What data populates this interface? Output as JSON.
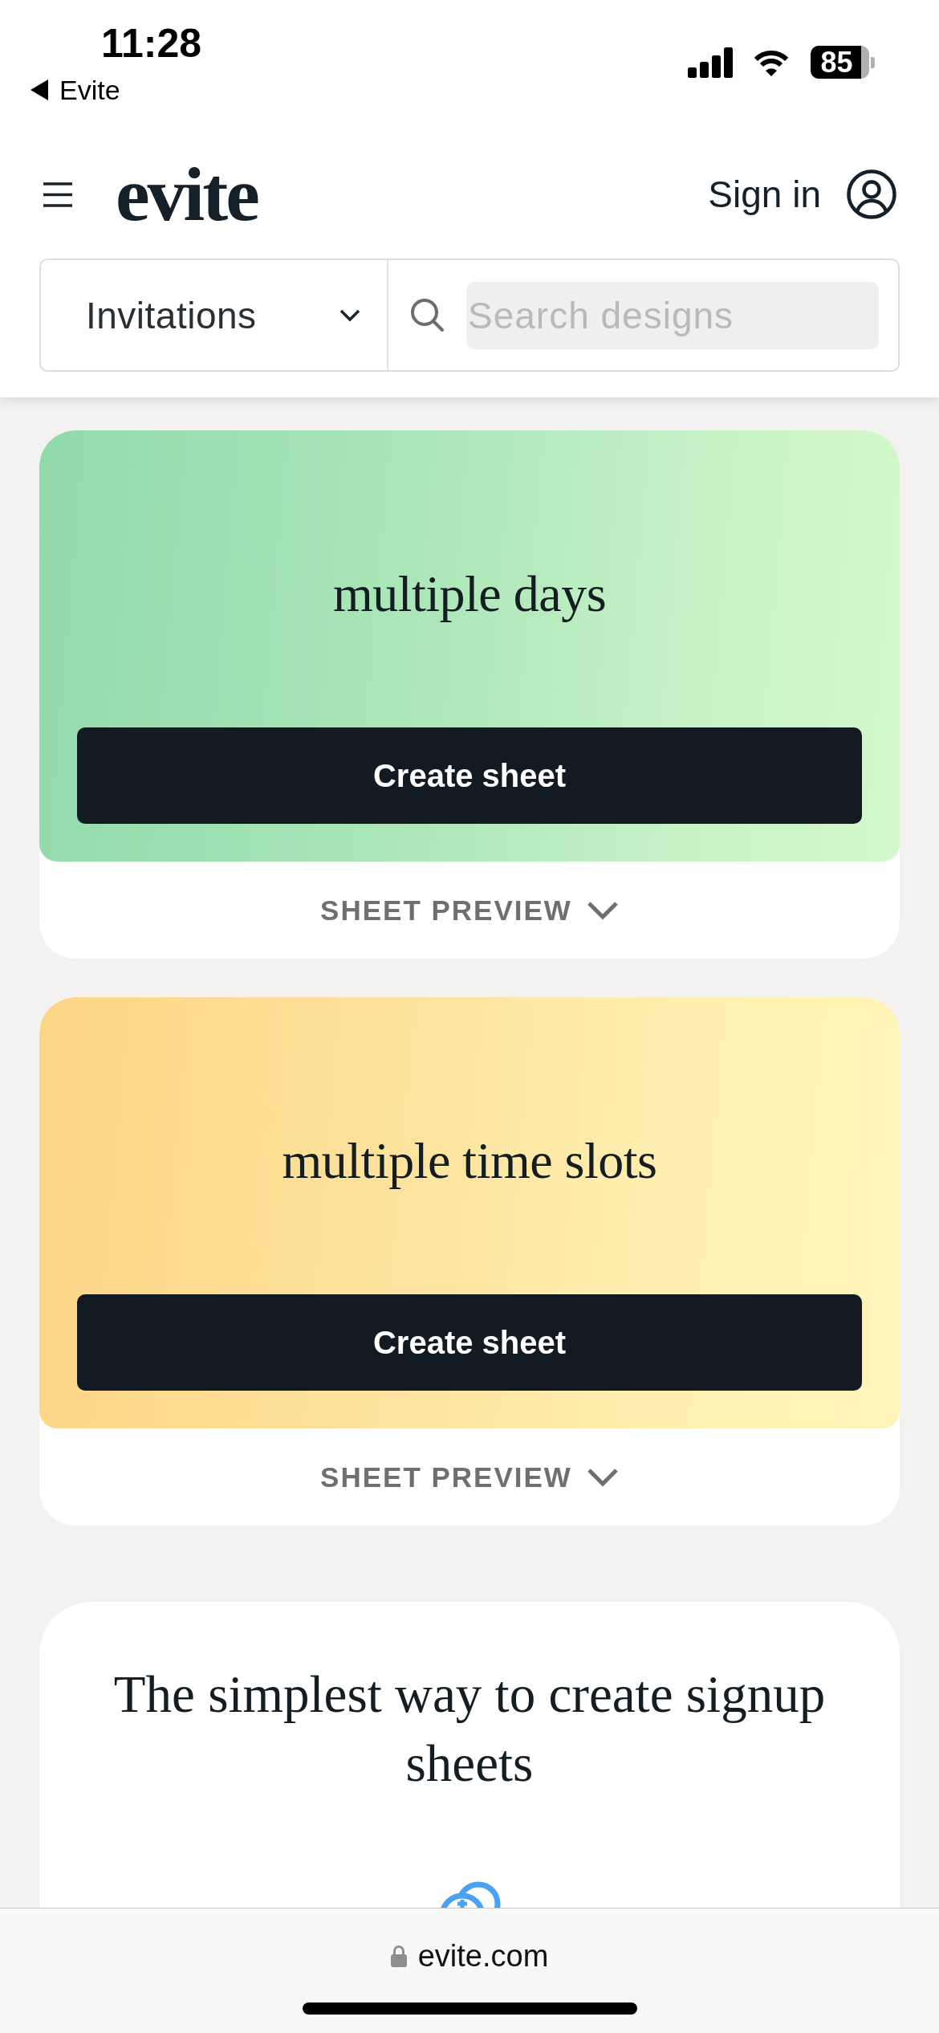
{
  "status_bar": {
    "time": "11:28",
    "back_label": "Evite",
    "battery": "85"
  },
  "header": {
    "logo": "evite",
    "sign_in": "Sign in"
  },
  "search_bar": {
    "category": "Invitations",
    "placeholder": "Search designs"
  },
  "sheet_cards": [
    {
      "kind": "green",
      "title": "multiple days",
      "button": "Create sheet",
      "preview_label": "SHEET PREVIEW"
    },
    {
      "kind": "yellow",
      "title": "multiple time slots",
      "button": "Create sheet",
      "preview_label": "SHEET PREVIEW"
    }
  ],
  "info_card": {
    "heading": "The simplest way to create signup sheets"
  },
  "browser_bar": {
    "url": "evite.com"
  }
}
